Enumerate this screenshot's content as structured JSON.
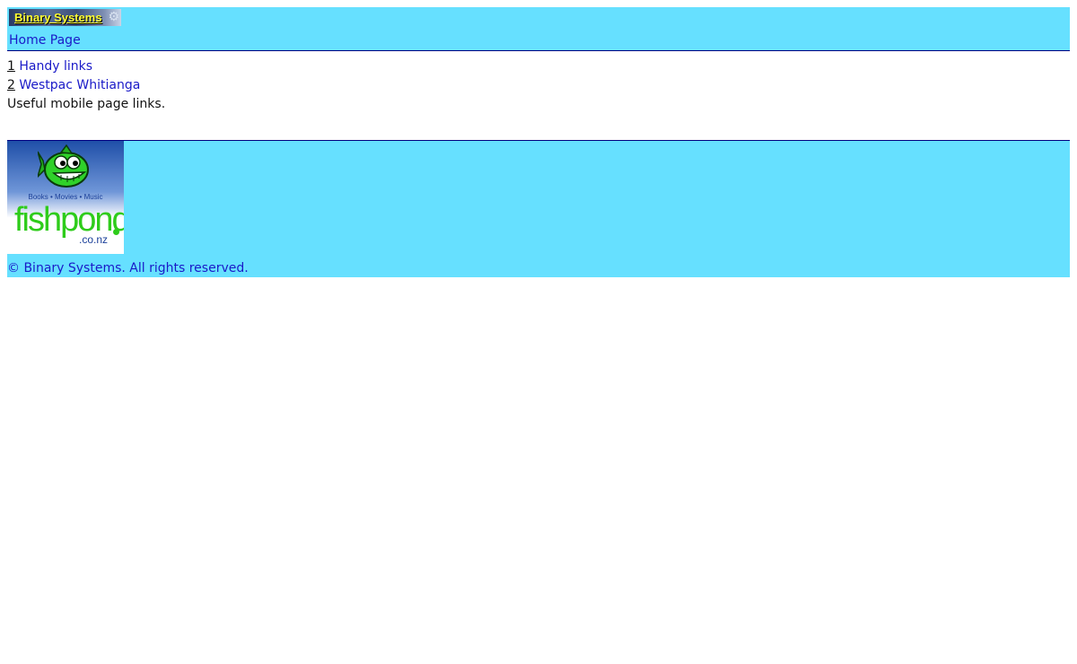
{
  "header": {
    "banner_text": "Binary Systems",
    "home_link": "Home Page"
  },
  "links": [
    {
      "number": "1",
      "label": "Handy links"
    },
    {
      "number": "2",
      "label": "Westpac Whitianga"
    }
  ],
  "description": "Useful mobile page links.",
  "footer": {
    "ad": {
      "tagline": "Books • Movies • Music",
      "brand": "fishpond",
      "domain": ".co.nz"
    },
    "copyright": "© Binary Systems. All rights reserved."
  },
  "colors": {
    "band": "#66e0ff",
    "link": "#1a1ac8",
    "banner_text": "#ffff33",
    "brand_green": "#2ecc1a"
  }
}
